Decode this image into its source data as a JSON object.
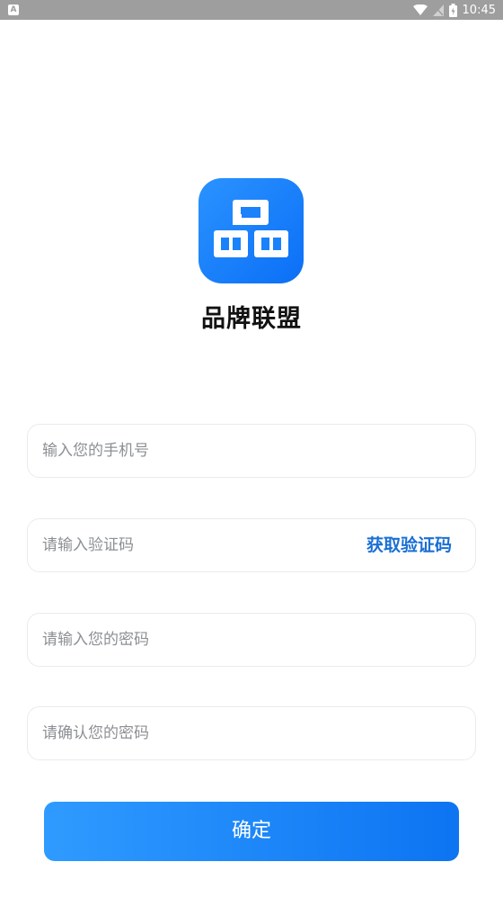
{
  "status_bar": {
    "time": "10:45",
    "left_badge": "A"
  },
  "app": {
    "name": "品牌联盟",
    "logo_icon": "pin-brand-logo-icon"
  },
  "form": {
    "phone_placeholder": "输入您的手机号",
    "code_placeholder": "请输入验证码",
    "get_code_label": "获取验证码",
    "password_placeholder": "请输入您的密码",
    "confirm_password_placeholder": "请确认您的密码",
    "submit_label": "确定"
  },
  "colors": {
    "accent": "#1a6fd4",
    "button_start": "#2f9bff",
    "button_end": "#0d74f2",
    "status_bar": "#9e9e9e"
  }
}
